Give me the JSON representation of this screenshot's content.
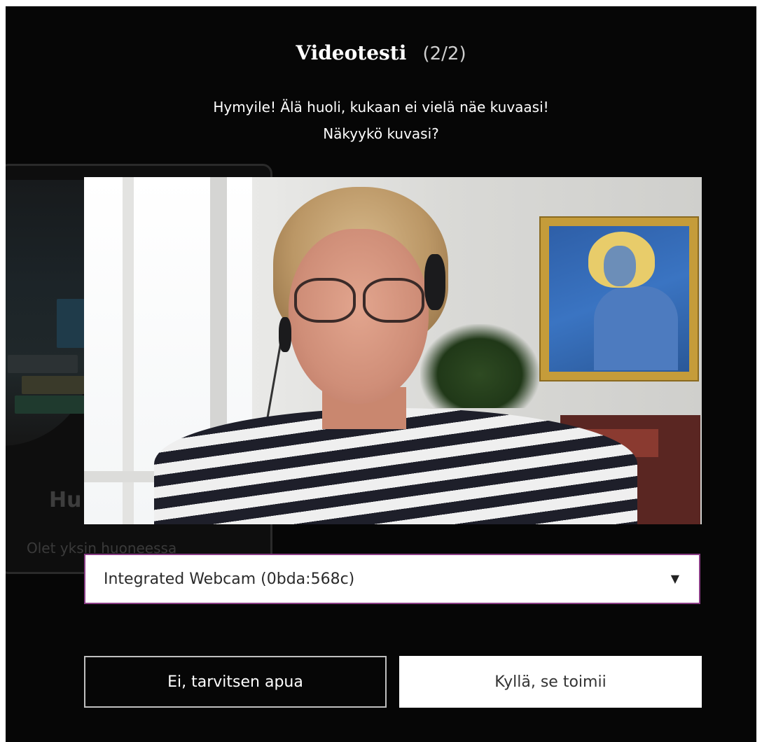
{
  "dialog": {
    "title": "Videotesti",
    "step": "(2/2)",
    "message_line1": "Hymyile! Älä huoli, kukaan ei vielä näe kuvaasi!",
    "message_line2": "Näkyykö kuvasi?"
  },
  "background": {
    "room_title": "Hu",
    "room_status": "Olet yksin huoneessa"
  },
  "camera_select": {
    "selected_value": "Integrated Webcam (0bda:568c)",
    "caret_icon": "▼",
    "border_color": "#8a3d86"
  },
  "buttons": {
    "no_label": "Ei, tarvitsen apua",
    "yes_label": "Kyllä, se toimii"
  },
  "colors": {
    "dialog_background": "#060606",
    "text": "#ffffff"
  }
}
